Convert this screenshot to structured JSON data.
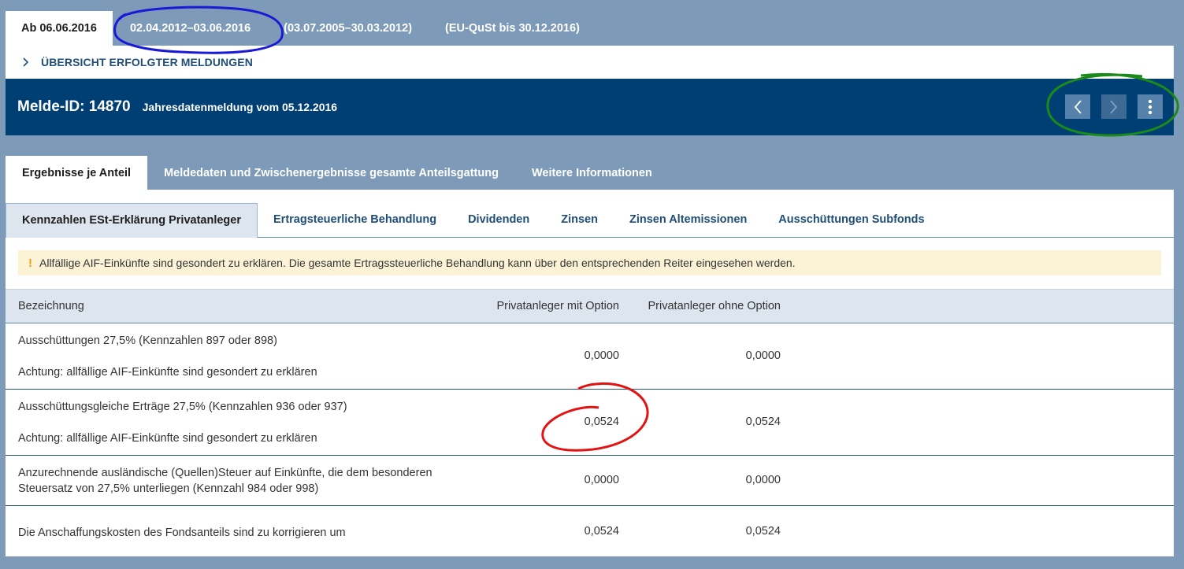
{
  "period_tabs": [
    "Ab 06.06.2016",
    "02.04.2012–03.06.2016",
    "(03.07.2005–30.03.2012)",
    "(EU-QuSt bis 30.12.2016)"
  ],
  "overview": {
    "label": "ÜBERSICHT ERFOLGTER MELDUNGEN"
  },
  "header": {
    "melde_id": "Melde-ID: 14870",
    "description": "Jahresdatenmeldung vom 05.12.2016"
  },
  "main_tabs": [
    "Ergebnisse je Anteil",
    "Meldedaten und Zwischenergebnisse gesamte Anteilsgattung",
    "Weitere Informationen"
  ],
  "sub_tabs": [
    "Kennzahlen ESt-Erklärung Privatanleger",
    "Ertragsteuerliche Behandlung",
    "Dividenden",
    "Zinsen",
    "Zinsen Altemissionen",
    "Ausschüttungen Subfonds"
  ],
  "notice": {
    "icon": "!",
    "text": "Allfällige AIF-Einkünfte sind gesondert zu erklären. Die gesamte Ertragssteuerliche Behandlung kann über den entsprechenden Reiter eingesehen werden."
  },
  "table": {
    "headers": [
      "Bezeichnung",
      "Privatanleger mit Option",
      "Privatanleger ohne Option"
    ],
    "rows": [
      {
        "label": "Ausschüttungen 27,5% (Kennzahlen 897 oder 898)",
        "note": "Achtung: allfällige AIF-Einkünfte sind gesondert zu erklären",
        "with_option": "0,0000",
        "without_option": "0,0000"
      },
      {
        "label": "Ausschüttungsgleiche Erträge 27,5% (Kennzahlen 936 oder 937)",
        "note": "Achtung: allfällige AIF-Einkünfte sind gesondert zu erklären",
        "with_option": "0,0524",
        "without_option": "0,0524"
      },
      {
        "label": "Anzurechnende ausländische (Quellen)Steuer auf Einkünfte, die dem besonderen Steuersatz von 27,5% unterliegen (Kennzahl 984 oder 998)",
        "note": "",
        "with_option": "0,0000",
        "without_option": "0,0000"
      },
      {
        "label": "Die Anschaffungskosten des Fondsanteils sind zu korrigieren um",
        "note": "",
        "with_option": "0,0524",
        "without_option": "0,0524"
      }
    ]
  },
  "icons": {
    "overview": "chevron-right-icon",
    "prev": "chevron-left-icon",
    "next": "chevron-right-icon",
    "more": "more-vertical-icon"
  },
  "colors": {
    "background": "#7d9bb8",
    "header_blue": "#003f73",
    "link_blue": "#1f4e79",
    "notice_bg": "#fcf3d7",
    "table_head_bg": "#dde6ef"
  }
}
